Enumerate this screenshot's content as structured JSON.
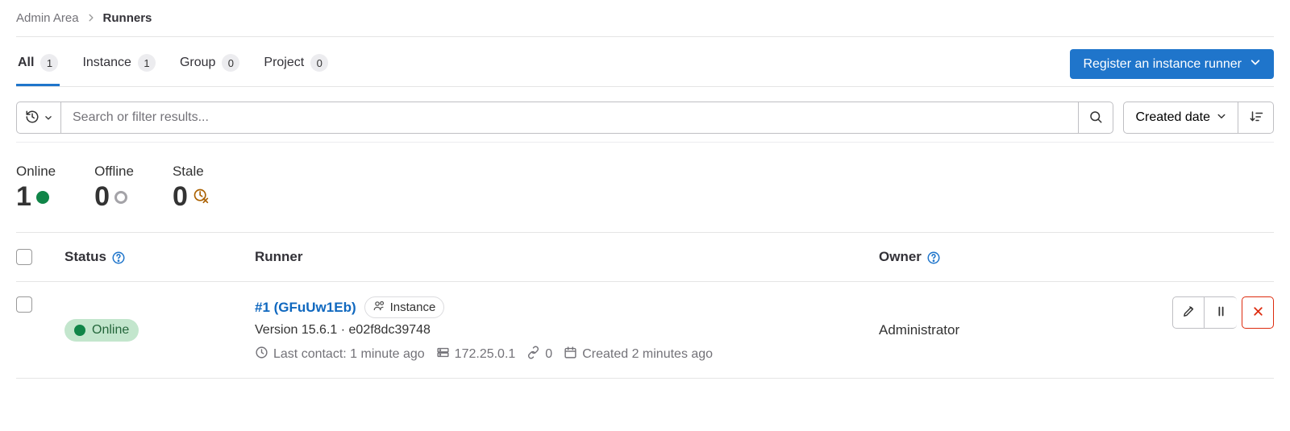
{
  "breadcrumb": {
    "parent": "Admin Area",
    "current": "Runners"
  },
  "tabs": {
    "all": {
      "label": "All",
      "count": "1"
    },
    "instance": {
      "label": "Instance",
      "count": "1"
    },
    "group": {
      "label": "Group",
      "count": "0"
    },
    "project": {
      "label": "Project",
      "count": "0"
    }
  },
  "register_button": "Register an instance runner",
  "search": {
    "placeholder": "Search or filter results..."
  },
  "sort": {
    "label": "Created date"
  },
  "stats": {
    "online": {
      "label": "Online",
      "value": "1"
    },
    "offline": {
      "label": "Offline",
      "value": "0"
    },
    "stale": {
      "label": "Stale",
      "value": "0"
    }
  },
  "columns": {
    "status": "Status",
    "runner": "Runner",
    "owner": "Owner"
  },
  "row": {
    "status": "Online",
    "id": "#1 (GFuUw1Eb)",
    "type": "Instance",
    "version_line": "Version 15.6.1 · e02f8dc39748",
    "last_contact": "Last contact: 1 minute ago",
    "ip": "172.25.0.1",
    "jobs": "0",
    "created": "Created 2 minutes ago",
    "owner": "Administrator"
  }
}
